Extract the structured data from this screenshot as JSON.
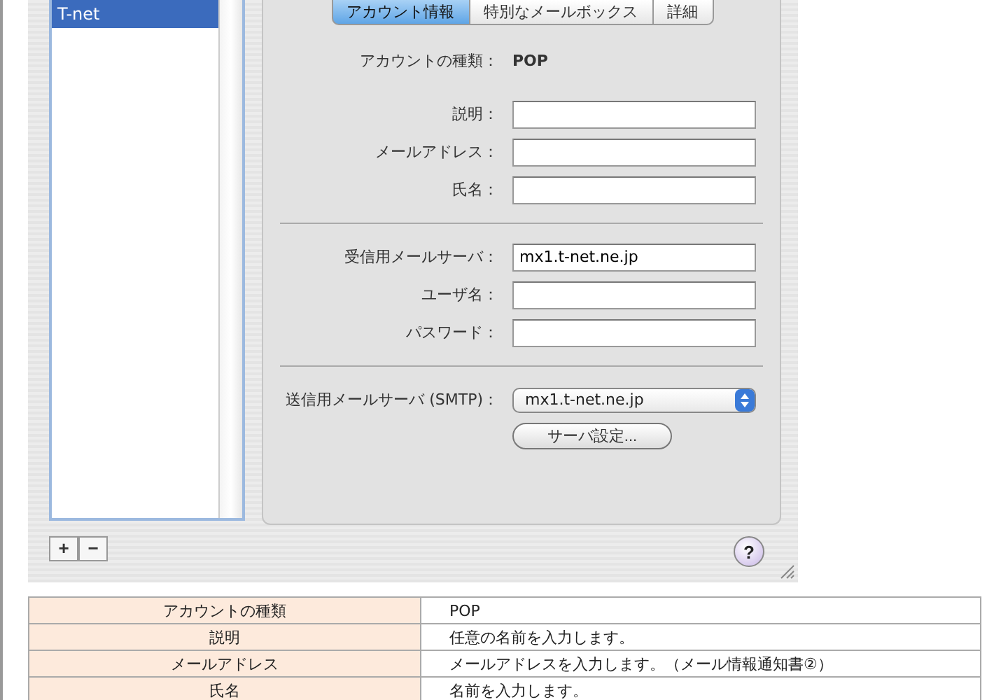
{
  "accounts": [
    {
      "name": "T-net",
      "selected": true
    }
  ],
  "tabs": [
    {
      "label": "アカウント情報",
      "selected": true
    },
    {
      "label": "特別なメールボックス",
      "selected": false
    },
    {
      "label": "詳細",
      "selected": false
    }
  ],
  "account_type": {
    "label": "アカウントの種類：",
    "value": "POP"
  },
  "sections": [
    [
      {
        "label": "説明："
      },
      {
        "label": "メールアドレス："
      },
      {
        "label": "氏名："
      }
    ],
    [
      {
        "label": "受信用メールサーバ：",
        "value": "mx1.t-net.ne.jp"
      },
      {
        "label": "ユーザ名："
      },
      {
        "label": "パスワード："
      }
    ]
  ],
  "smtp": {
    "label": "送信用メールサーバ (SMTP)：",
    "value": "mx1.t-net.ne.jp",
    "button": "サーバ設定..."
  },
  "list_buttons": [
    "+",
    "−"
  ],
  "help_button": "?",
  "table": {
    "rows": [
      {
        "term": "アカウントの種類",
        "description": "POP"
      },
      {
        "term": "説明",
        "description": "任意の名前を入力します。"
      },
      {
        "term": "メールアドレス",
        "description": "メールアドレスを入力します。（メール情報通知書②）"
      },
      {
        "term": "氏名",
        "description": "名前を入力します。"
      }
    ]
  }
}
